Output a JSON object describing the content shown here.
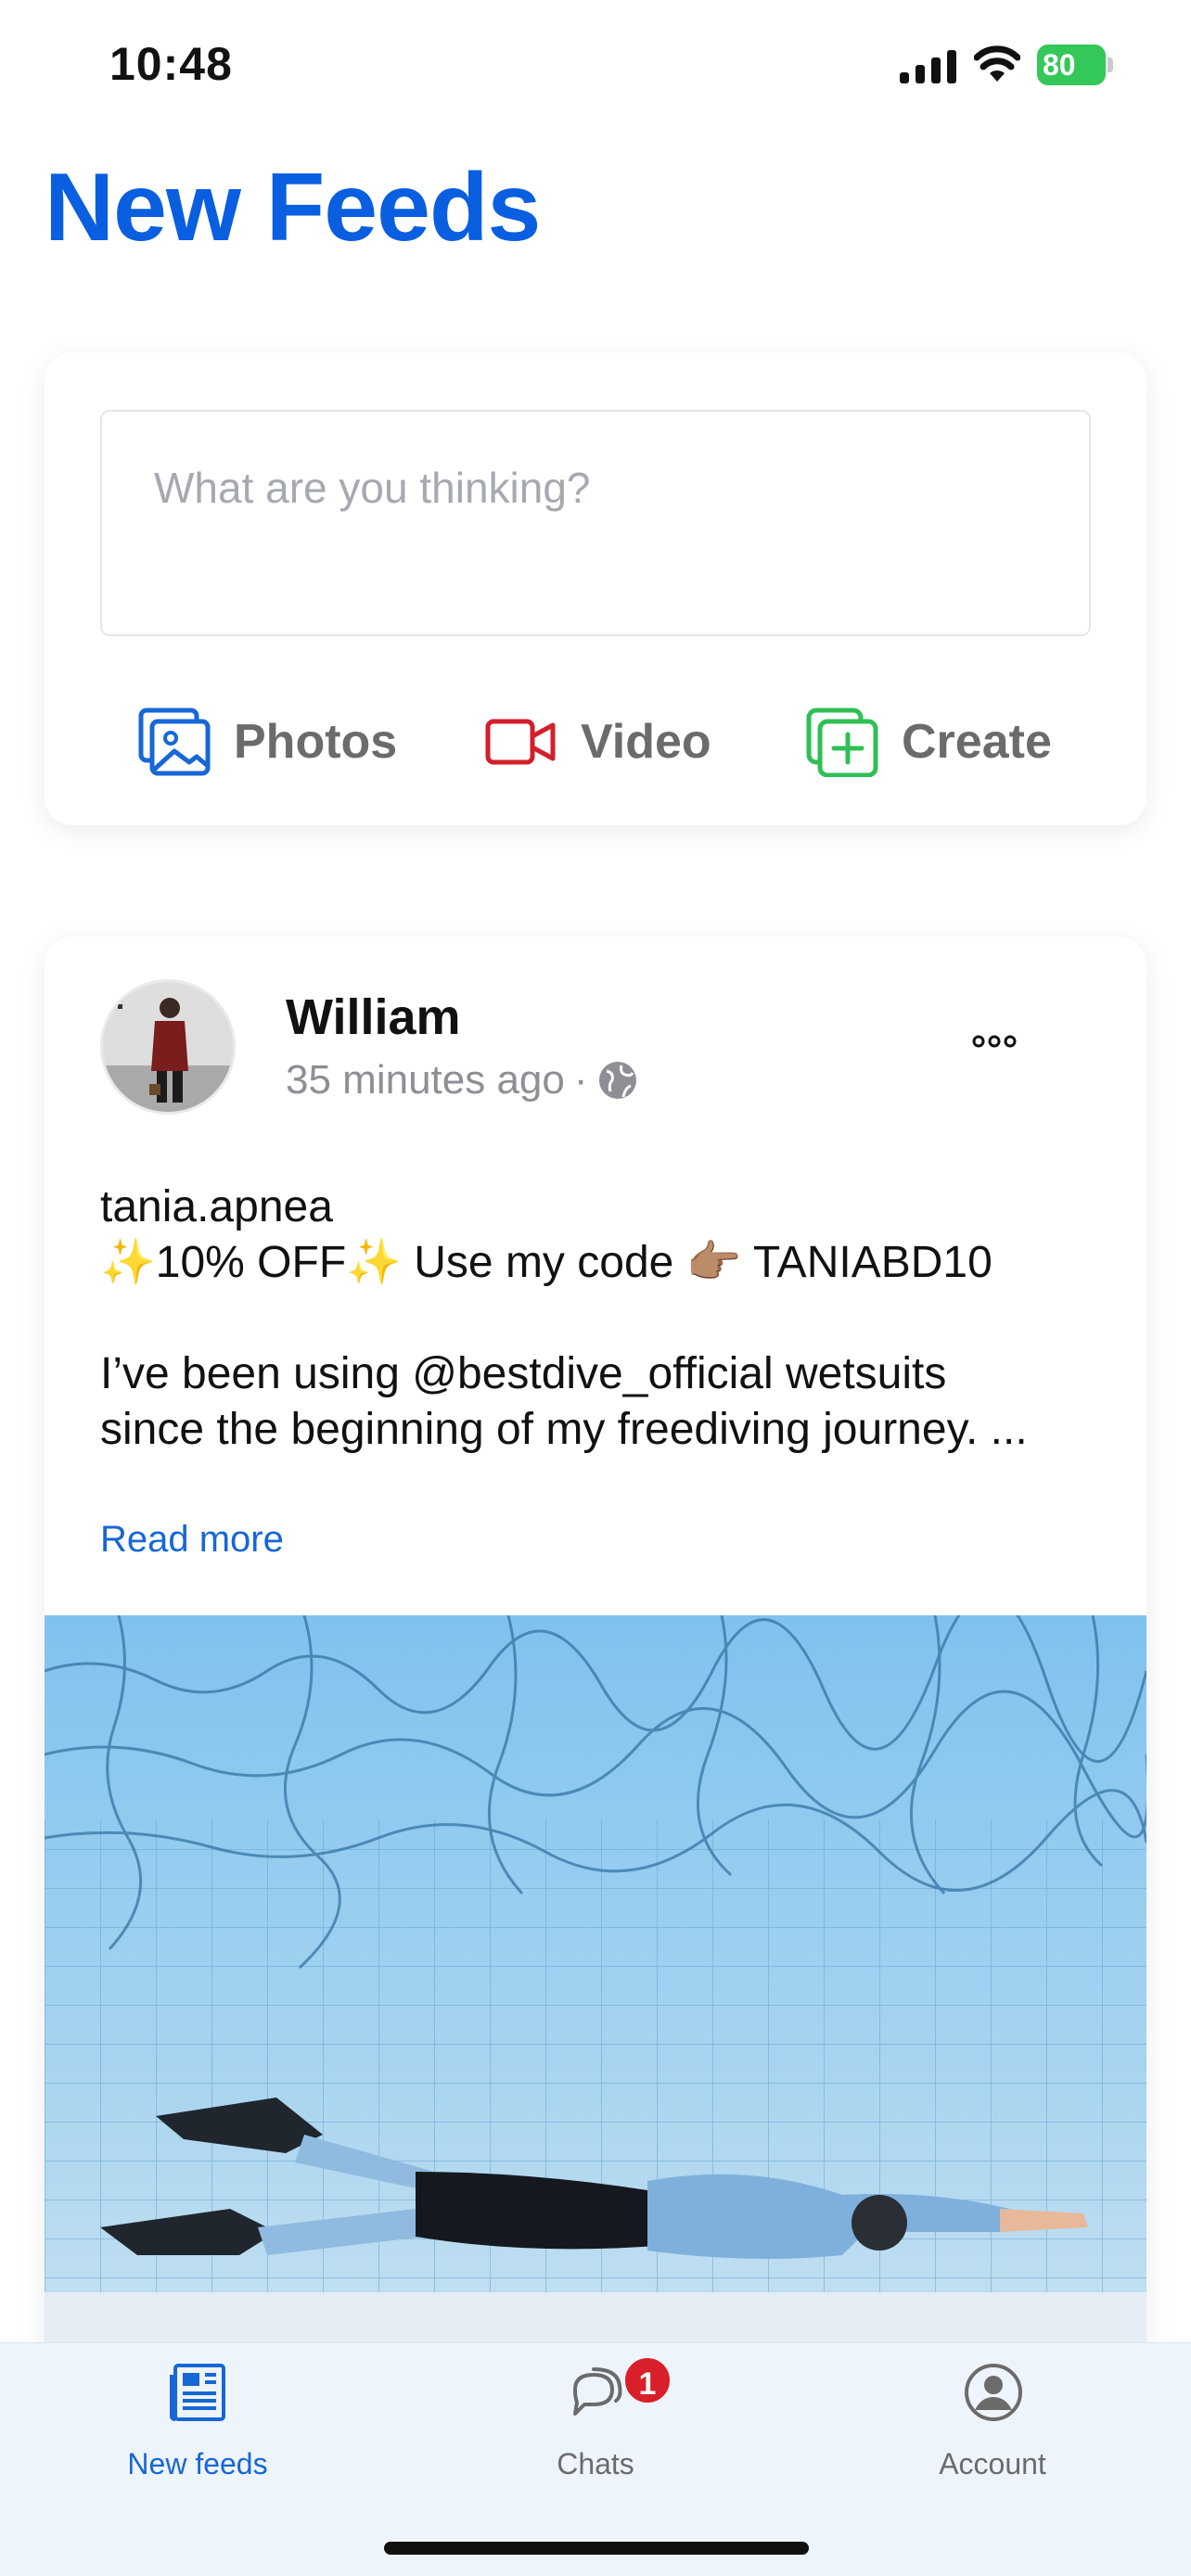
{
  "status_bar": {
    "time": "10:48",
    "battery": "80"
  },
  "page": {
    "title": "New Feeds"
  },
  "composer": {
    "placeholder": "What are you thinking?",
    "actions": [
      {
        "label": "Photos",
        "icon": "photos-icon",
        "color": "#1767d6"
      },
      {
        "label": "Video",
        "icon": "video-icon",
        "color": "#d21f2b"
      },
      {
        "label": "Create",
        "icon": "create-icon",
        "color": "#2fbf55"
      }
    ]
  },
  "post": {
    "author": "William",
    "time": "35 minutes ago",
    "separator": "·",
    "lines": [
      "tania.apnea",
      "✨10% OFF✨ Use my code 👉🏽 TANIABD10",
      "I’ve been using @bestdive_official wetsuits",
      "since the beginning of my freediving journey. ..."
    ],
    "read_more": "Read more"
  },
  "tabbar": {
    "tabs": [
      {
        "label": "New feeds",
        "icon": "newspaper-icon",
        "active": true
      },
      {
        "label": "Chats",
        "icon": "chat-bubbles-icon",
        "badge": "1"
      },
      {
        "label": "Account",
        "icon": "account-icon"
      }
    ]
  },
  "colors": {
    "accent": "#0a5ee0",
    "badge": "#d9202a",
    "battery": "#34c759"
  }
}
